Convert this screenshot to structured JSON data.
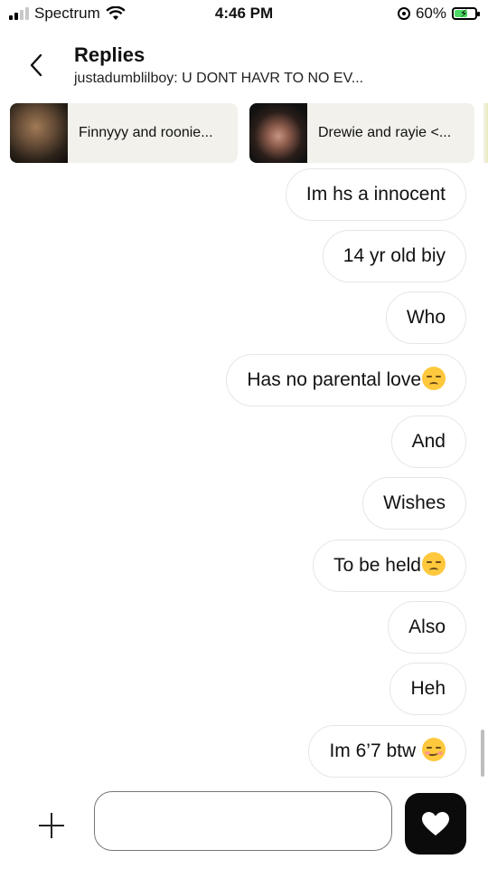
{
  "status_bar": {
    "carrier": "Spectrum",
    "time": "4:46 PM",
    "battery_percent": "60%",
    "signal_bars": 4,
    "signal_active": 2,
    "icons": [
      "signal-icon",
      "wifi-icon",
      "orientation-lock-icon",
      "battery-charging-icon"
    ]
  },
  "header": {
    "title": "Replies",
    "subtitle": "justadumblilboy: U DONT HAVR TO NO EV..."
  },
  "cards": [
    {
      "label": "Finnyyy and roonie..."
    },
    {
      "label": "Drewie and rayie <..."
    }
  ],
  "messages": [
    {
      "text": "Im hs a innocent",
      "emoji": ""
    },
    {
      "text": "14 yr old biy",
      "emoji": ""
    },
    {
      "text": "Who",
      "emoji": ""
    },
    {
      "text": "Has no parental love",
      "emoji": "pensive-face-emoji"
    },
    {
      "text": "And",
      "emoji": ""
    },
    {
      "text": "Wishes",
      "emoji": ""
    },
    {
      "text": "To be held",
      "emoji": "pensive-face-emoji"
    },
    {
      "text": "Also",
      "emoji": ""
    },
    {
      "text": "Heh",
      "emoji": ""
    },
    {
      "text": "Im 6’7 btw ",
      "emoji": "smirking-face-emoji"
    }
  ],
  "composer": {
    "placeholder": "",
    "value": ""
  },
  "colors": {
    "card_bg": "#f2f1ec",
    "bubble_border": "#e6e6e6",
    "send_button": "#0b0b0b",
    "battery_fill": "#4cd964"
  }
}
